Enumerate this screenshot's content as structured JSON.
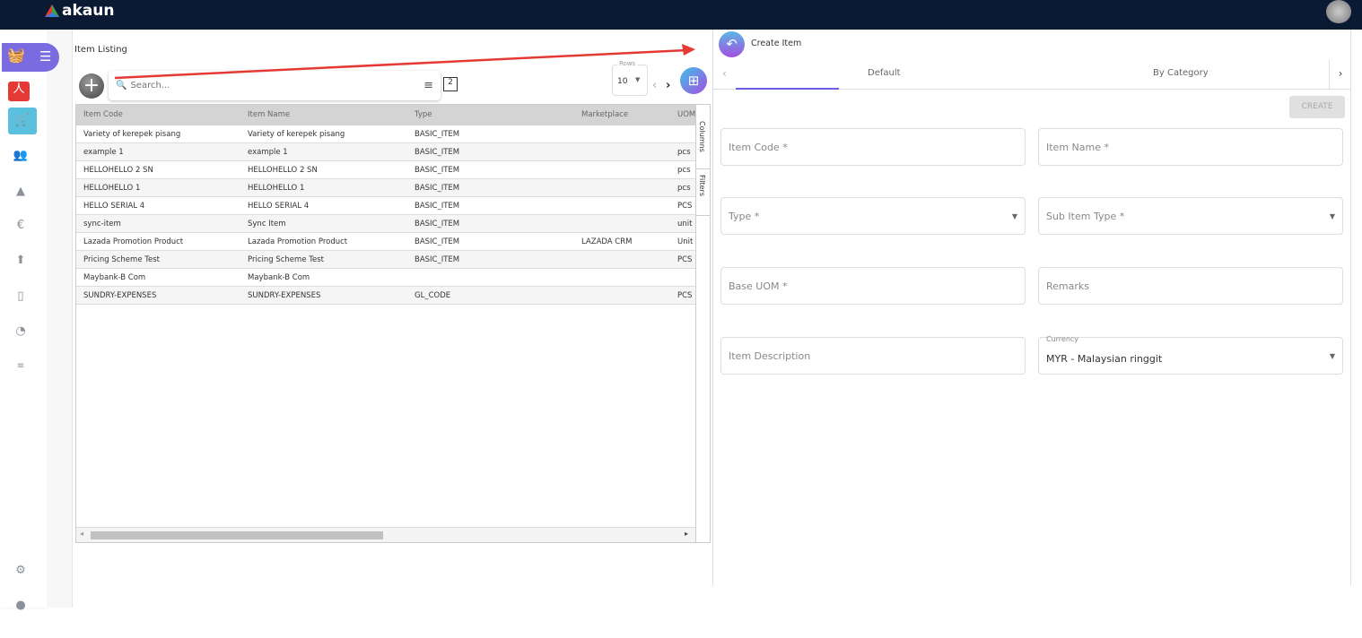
{
  "app": {
    "name": "akaun"
  },
  "left": {
    "title": "Item Listing",
    "search_placeholder": "Search...",
    "rows_label": "Rows",
    "rows_value": "10",
    "columns": [
      "Item Code",
      "Item Name",
      "Type",
      "Marketplace",
      "UOM"
    ],
    "rows": [
      [
        "Variety of kerepek pisang",
        "Variety of kerepek pisang",
        "BASIC_ITEM",
        "",
        ""
      ],
      [
        "example 1",
        "example 1",
        "BASIC_ITEM",
        "",
        "pcs"
      ],
      [
        "HELLOHELLO 2 SN",
        "HELLOHELLO 2 SN",
        "BASIC_ITEM",
        "",
        "pcs"
      ],
      [
        "HELLOHELLO 1",
        "HELLOHELLO 1",
        "BASIC_ITEM",
        "",
        "pcs"
      ],
      [
        "HELLO SERIAL 4",
        "HELLO SERIAL 4",
        "BASIC_ITEM",
        "",
        "PCS"
      ],
      [
        "sync-item",
        "Sync Item",
        "BASIC_ITEM",
        "",
        "unit"
      ],
      [
        "Lazada Promotion Product",
        "Lazada Promotion Product",
        "BASIC_ITEM",
        "LAZADA CRM",
        "Unit"
      ],
      [
        "Pricing Scheme Test",
        "Pricing Scheme Test",
        "BASIC_ITEM",
        "",
        "PCS"
      ],
      [
        "Maybank-B Com",
        "Maybank-B Com",
        "",
        "",
        ""
      ],
      [
        "SUNDRY-EXPENSES",
        "SUNDRY-EXPENSES",
        "GL_CODE",
        "",
        "PCS"
      ]
    ],
    "side_columns": "Columns",
    "side_filters": "Filters"
  },
  "right": {
    "title": "Create Item",
    "tabs": [
      "Default",
      "By Category"
    ],
    "create_label": "CREATE",
    "fields": {
      "item_code": "Item Code *",
      "item_name": "Item Name *",
      "type": "Type *",
      "sub_item_type": "Sub Item Type *",
      "base_uom": "Base UOM *",
      "remarks": "Remarks",
      "item_description": "Item Description",
      "currency_label": "Currency",
      "currency_value": "MYR - Malaysian ringgit"
    }
  },
  "colors": {
    "topbar": "#0b1a33",
    "accent": "#7b6be0",
    "annotation": "#e53935"
  }
}
